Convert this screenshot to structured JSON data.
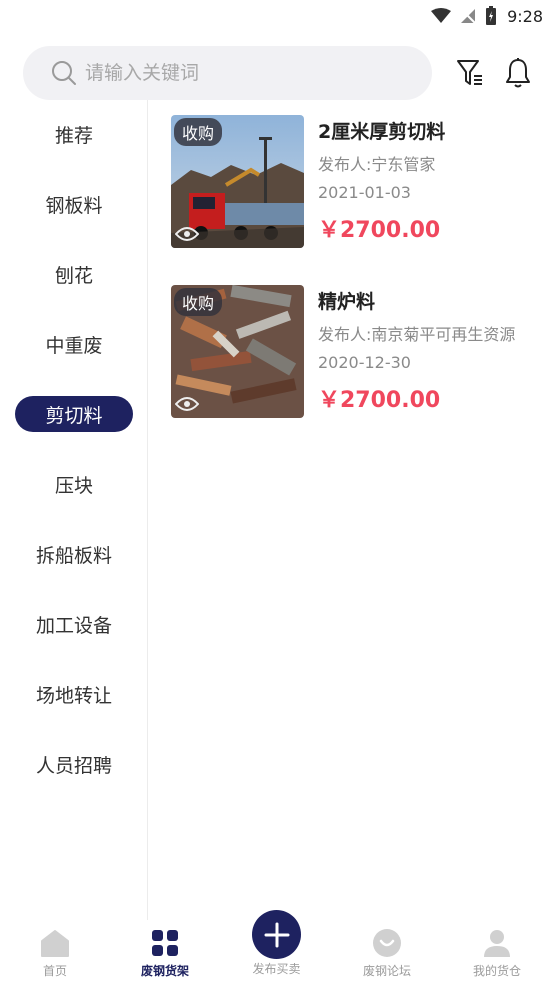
{
  "status_bar": {
    "time": "9:28"
  },
  "search": {
    "placeholder": "请输入关键词"
  },
  "sidebar": {
    "items": [
      {
        "label": "推荐"
      },
      {
        "label": "钢板料"
      },
      {
        "label": "刨花"
      },
      {
        "label": "中重废"
      },
      {
        "label": "剪切料",
        "active": true
      },
      {
        "label": "压块"
      },
      {
        "label": "拆船板料"
      },
      {
        "label": "加工设备"
      },
      {
        "label": "场地转让"
      },
      {
        "label": "人员招聘"
      }
    ]
  },
  "listings": [
    {
      "tag": "收购",
      "title": "2厘米厚剪切料",
      "publisher": "发布人:宁东管家",
      "date": "2021-01-03",
      "price": "￥2700.00"
    },
    {
      "tag": "收购",
      "title": "精炉料",
      "publisher": "发布人:南京菊平可再生资源",
      "date": "2020-12-30",
      "price": "￥2700.00"
    }
  ],
  "bottom_nav": {
    "items": [
      {
        "label": "首页",
        "icon": "home-icon"
      },
      {
        "label": "废钢货架",
        "icon": "grid-icon",
        "active": true
      },
      {
        "label": "发布买卖",
        "icon": "plus-icon"
      },
      {
        "label": "废钢论坛",
        "icon": "forum-icon"
      },
      {
        "label": "我的货仓",
        "icon": "user-icon"
      }
    ]
  },
  "colors": {
    "accent": "#1e2260",
    "price": "#f0475d",
    "muted": "#9b9b9b"
  }
}
